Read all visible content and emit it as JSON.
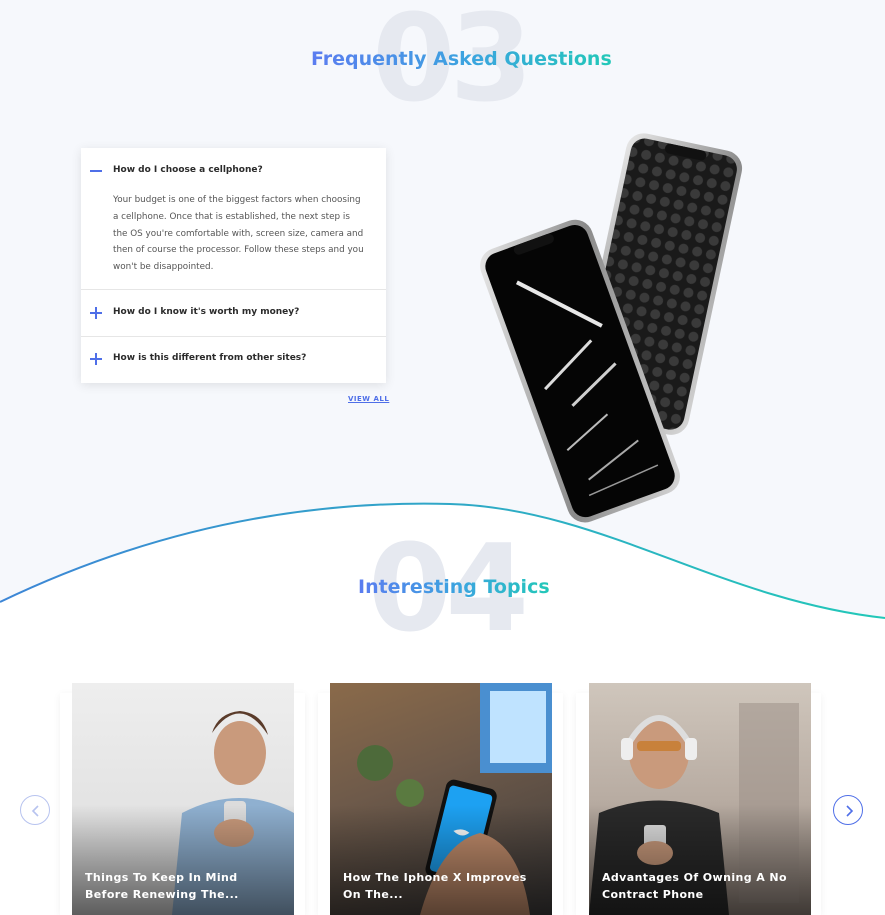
{
  "faq": {
    "number": "03",
    "title": "Frequently Asked Questions",
    "items": [
      {
        "question": "How do I choose a cellphone?",
        "answer": "Your budget is one of the biggest factors when choosing a cellphone. Once that is established, the next step is the OS you're comfortable with, screen size, camera and then of course the processor. Follow these steps and you won't be disappointed.",
        "icon": "minus-icon"
      },
      {
        "question": "How do I know it's worth my money?",
        "icon": "plus-icon"
      },
      {
        "question": "How is this different from other sites?",
        "icon": "plus-icon"
      }
    ],
    "view_all": "VIEW ALL"
  },
  "topics": {
    "number": "04",
    "title": "Interesting Topics",
    "cards": [
      {
        "title": "Things To Keep In Mind Before Renewing The..."
      },
      {
        "title": "How The Iphone X Improves On The..."
      },
      {
        "title": "Advantages Of Owning A No Contract Phone"
      }
    ],
    "prev_icon": "chevron-left-icon",
    "next_icon": "chevron-right-icon"
  },
  "colors": {
    "accent": "#4f6fe8",
    "gradient_start": "#5b7cf0",
    "gradient_end": "#22c8b8",
    "page_bg": "#f6f8fc"
  }
}
